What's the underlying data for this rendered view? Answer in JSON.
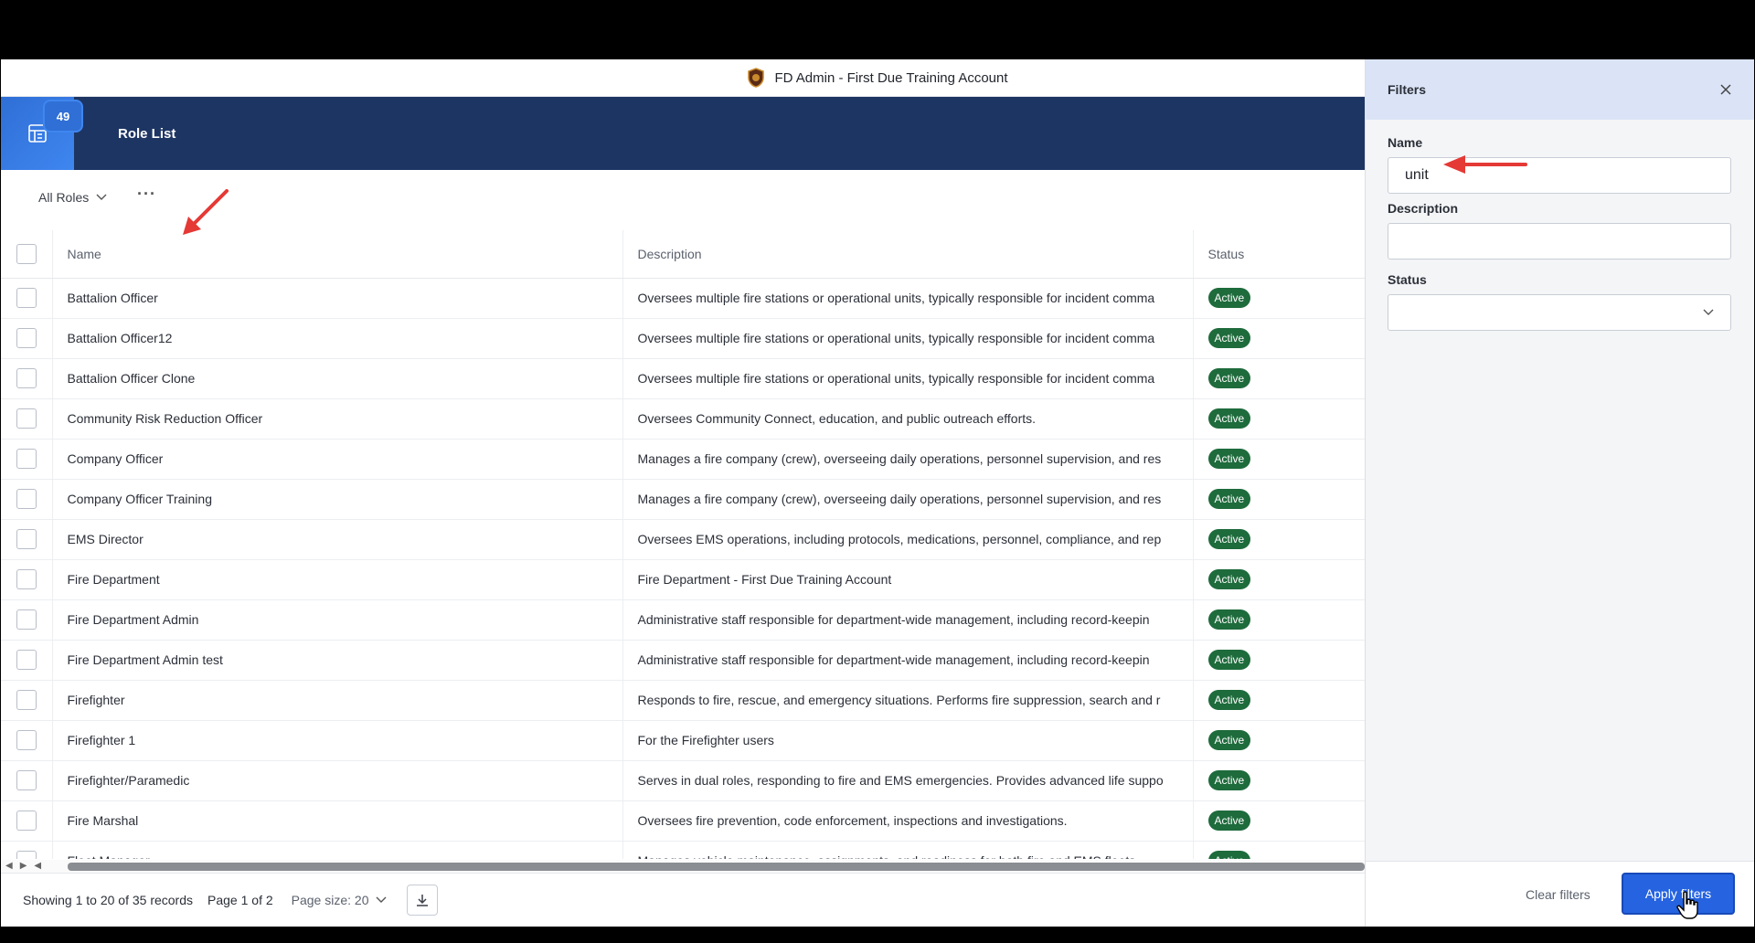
{
  "window": {
    "title": "FD Admin - First Due Training Account"
  },
  "header": {
    "badge_count": "49",
    "page_title": "Role List"
  },
  "toolbar": {
    "view_label": "All Roles",
    "more_label": "···"
  },
  "table": {
    "columns": {
      "name": "Name",
      "description": "Description",
      "status": "Status"
    },
    "rows": [
      {
        "name": "Battalion Officer",
        "description": "Oversees multiple fire stations or operational units, typically responsible for incident comma",
        "status": "Active"
      },
      {
        "name": "Battalion Officer12",
        "description": "Oversees multiple fire stations or operational units, typically responsible for incident comma",
        "status": "Active"
      },
      {
        "name": "Battalion Officer Clone",
        "description": "Oversees multiple fire stations or operational units, typically responsible for incident comma",
        "status": "Active"
      },
      {
        "name": "Community Risk Reduction Officer",
        "description": "Oversees Community Connect, education, and public outreach efforts.",
        "status": "Active"
      },
      {
        "name": "Company Officer",
        "description": "Manages a fire company (crew), overseeing daily operations, personnel supervision, and res",
        "status": "Active"
      },
      {
        "name": "Company Officer Training",
        "description": "Manages a fire company (crew), overseeing daily operations, personnel supervision, and res",
        "status": "Active"
      },
      {
        "name": "EMS Director",
        "description": "Oversees EMS operations, including protocols, medications, personnel, compliance, and rep",
        "status": "Active"
      },
      {
        "name": "Fire Department",
        "description": "Fire Department - First Due Training Account",
        "status": "Active"
      },
      {
        "name": "Fire Department Admin",
        "description": "Administrative staff responsible for department-wide management, including record-keepin",
        "status": "Active"
      },
      {
        "name": "Fire Department Admin test",
        "description": "Administrative staff responsible for department-wide management, including record-keepin",
        "status": "Active"
      },
      {
        "name": "Firefighter",
        "description": "Responds to fire, rescue, and emergency situations. Performs fire suppression, search and r",
        "status": "Active"
      },
      {
        "name": "Firefighter 1",
        "description": "For the Firefighter users",
        "status": "Active"
      },
      {
        "name": "Firefighter/Paramedic",
        "description": "Serves in dual roles, responding to fire and EMS emergencies. Provides advanced life suppo",
        "status": "Active"
      },
      {
        "name": "Fire Marshal",
        "description": "Oversees fire prevention, code enforcement, inspections and investigations.",
        "status": "Active"
      },
      {
        "name": "Fleet Manager",
        "description": "Manages vehicle maintenance, assignments, and readiness for both fire and EMS fleets.",
        "status": "Active"
      }
    ]
  },
  "footer": {
    "records": "Showing 1 to 20 of 35 records",
    "page": "Page 1 of 2",
    "page_size": "Page size: 20"
  },
  "filters": {
    "title": "Filters",
    "name_label": "Name",
    "name_value": "unit",
    "description_label": "Description",
    "description_value": "",
    "status_label": "Status",
    "status_value": "",
    "clear_label": "Clear filters",
    "apply_label": "Apply filters"
  },
  "colors": {
    "header": "#1d3563",
    "accent": "#2563e0",
    "status_active": "#1e6b3c",
    "annotation": "#e53935"
  }
}
